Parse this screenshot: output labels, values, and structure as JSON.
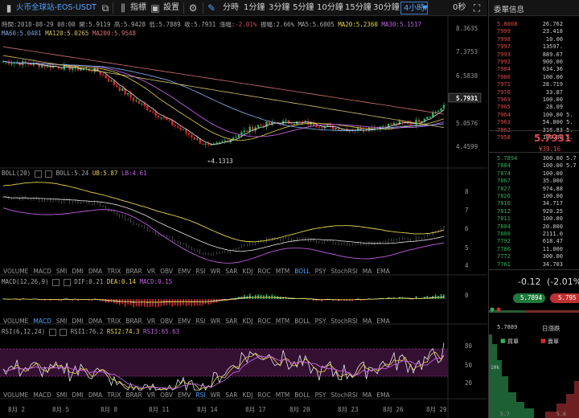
{
  "toolbar": {
    "symbol": "火币全球站-EOS-USDT",
    "indicator_label": "指標",
    "settings_label": "設置",
    "intervals": [
      "分時",
      "1分鐘",
      "3分鐘",
      "5分鐘",
      "10分鐘",
      "15分鐘",
      "30分鐘"
    ],
    "active_interval": "4小時",
    "countdown": "0秒",
    "panel_title": "委單信息"
  },
  "main_info": {
    "time": "時間:2018-08-29 08:00",
    "open": "開:5.9119",
    "high": "高:5.9428",
    "low": "低:5.7889",
    "close": "收:5.7931",
    "change_label": "漲幅:",
    "change_value": "-2.01%",
    "amplitude": "振幅:2.66%",
    "ma5": "MA5:5.6805",
    "ma20": "MA20:5.2360",
    "ma30": "MA30:5.1517",
    "ma60": "MA60:5.0481",
    "ma120": "MA120:5.0265",
    "ma200": "MA200:5.9548"
  },
  "price_axis": [
    "8.3635",
    "7.3753",
    "6.5838",
    "5.0576",
    "4.4599"
  ],
  "current_price_tag": "5.7931",
  "low_marker": "←4.1313",
  "boll_info": {
    "name": "BOLL(20)",
    "boll": "BOLL:5.24",
    "ub": "UB:5.87",
    "lb": "LB:4.61"
  },
  "boll_axis": [
    "8",
    "7",
    "6",
    "5",
    "4"
  ],
  "indicator_tabs": [
    "VOLUME",
    "MACD",
    "SMI",
    "DMI",
    "DMA",
    "TRIX",
    "BRAR",
    "VR",
    "OBV",
    "EMV",
    "RSI",
    "WR",
    "SAR",
    "KDJ",
    "ROC",
    "MTM",
    "BOLL",
    "PSY",
    "StochRSI",
    "MA",
    "EMA"
  ],
  "macd_info": {
    "name": "MACD(12,26,9)",
    "dif": "DIF:0.21",
    "dea": "DEA:0.14",
    "macd": "MACD:0.15"
  },
  "macd_axis": [
    "0"
  ],
  "rsi_info": {
    "name": "RSI(6,12,24)",
    "rsi1": "RSI1:76.2",
    "rsi2": "RSI2:74.3",
    "rsi3": "RSI3:65.63"
  },
  "rsi_axis": [
    "80",
    "50",
    "20"
  ],
  "date_axis": [
    "8月 2",
    "8月 5",
    "8月 8",
    "8月 11",
    "8月 14",
    "8月 17",
    "8月 20",
    "8月 23",
    "8月 26",
    "8月 29"
  ],
  "orderbook": {
    "asks": [
      {
        "price": "5.8008",
        "amount": "26.762",
        "extra": ""
      },
      {
        "price": "7999",
        "amount": "23.418",
        "extra": ""
      },
      {
        "price": "7998",
        "amount": "10.00",
        "extra": ""
      },
      {
        "price": "7997",
        "amount": "13597.",
        "extra": ""
      },
      {
        "price": "7993",
        "amount": "889.67",
        "extra": ""
      },
      {
        "price": "7992",
        "amount": "900.00",
        "extra": ""
      },
      {
        "price": "7984",
        "amount": "634.36",
        "extra": ""
      },
      {
        "price": "7980",
        "amount": "100.00",
        "extra": ""
      },
      {
        "price": "7971",
        "amount": "28.719",
        "extra": ""
      },
      {
        "price": "7970",
        "amount": "33.87",
        "extra": ""
      },
      {
        "price": "7969",
        "amount": "100.00",
        "extra": ""
      },
      {
        "price": "7965",
        "amount": "28.09",
        "extra": ""
      },
      {
        "price": "7964",
        "amount": "100.00",
        "extra": "5."
      },
      {
        "price": "7963",
        "amount": "54.000",
        "extra": "5."
      },
      {
        "price": "7962",
        "amount": "316.83",
        "extra": "5."
      },
      {
        "price": "7958",
        "amount": "100.00",
        "extra": "5."
      }
    ],
    "last_price": "5.7931",
    "last_price_sub": "¥39.16",
    "bids": [
      {
        "price": "5.7894",
        "amount": "300.00",
        "extra": "5.7"
      },
      {
        "price": "7884",
        "amount": "100.00",
        "extra": "5.7"
      },
      {
        "price": "7874",
        "amount": "100.00",
        "extra": ""
      },
      {
        "price": "7867",
        "amount": "35.000",
        "extra": ""
      },
      {
        "price": "7827",
        "amount": "974.88",
        "extra": ""
      },
      {
        "price": "7826",
        "amount": "100.00",
        "extra": ""
      },
      {
        "price": "7816",
        "amount": "34.717",
        "extra": ""
      },
      {
        "price": "7812",
        "amount": "920.25",
        "extra": ""
      },
      {
        "price": "7811",
        "amount": "100.00",
        "extra": ""
      },
      {
        "price": "7804",
        "amount": "20.000",
        "extra": ""
      },
      {
        "price": "7800",
        "amount": "2111.0",
        "extra": ""
      },
      {
        "price": "7792",
        "amount": "618.47",
        "extra": ""
      },
      {
        "price": "7780",
        "amount": "11.000",
        "extra": ""
      },
      {
        "price": "7772",
        "amount": "300.00",
        "extra": ""
      },
      {
        "price": "7761",
        "amount": "34.703",
        "extra": ""
      }
    ],
    "change": "-0.12",
    "change_pct": "(-2.01%",
    "bid_button": "5.7894",
    "ask_button": "5.795",
    "depth_price": "5.7889",
    "depth_title": "日漲跌",
    "depth_buy": "買單",
    "depth_sell": "賣單",
    "depth_scale": "10k",
    "depth_axis": [
      "5.7",
      "5.8"
    ]
  },
  "colors": {
    "up": "#d02a2a",
    "down": "#2fb05a",
    "accent": "#4ea3ff",
    "ma_white": "#e6e6e6",
    "ma_yellow": "#e8d44d",
    "ma_purple": "#c060e0",
    "ma_blue": "#7aa6e0"
  }
}
